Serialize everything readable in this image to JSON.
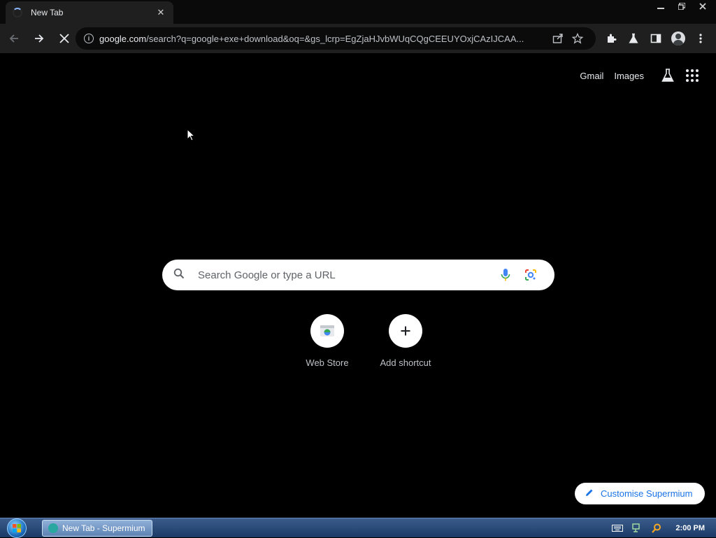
{
  "tab": {
    "title": "New Tab",
    "close_label": "✕"
  },
  "toolbar": {
    "url_host": "google.com",
    "url_rest": "/search?q=google+exe+download&oq=&gs_lcrp=EgZjaHJvbWUqCQgCEEUYOxjCAzIJCAA..."
  },
  "ntp": {
    "gmail": "Gmail",
    "images": "Images",
    "search_placeholder": "Search Google or type a URL",
    "shortcuts": [
      {
        "label": "Web Store",
        "icon": "web-store-icon"
      },
      {
        "label": "Add shortcut",
        "icon": "plus-icon"
      }
    ],
    "customise": "Customise Supermium"
  },
  "taskbar": {
    "task_label": "New Tab - Supermium",
    "clock": "2:00 PM"
  },
  "colors": {
    "accent": "#1a73e8",
    "page_bg": "#000000",
    "toolbar_bg": "#1f1f1f"
  }
}
